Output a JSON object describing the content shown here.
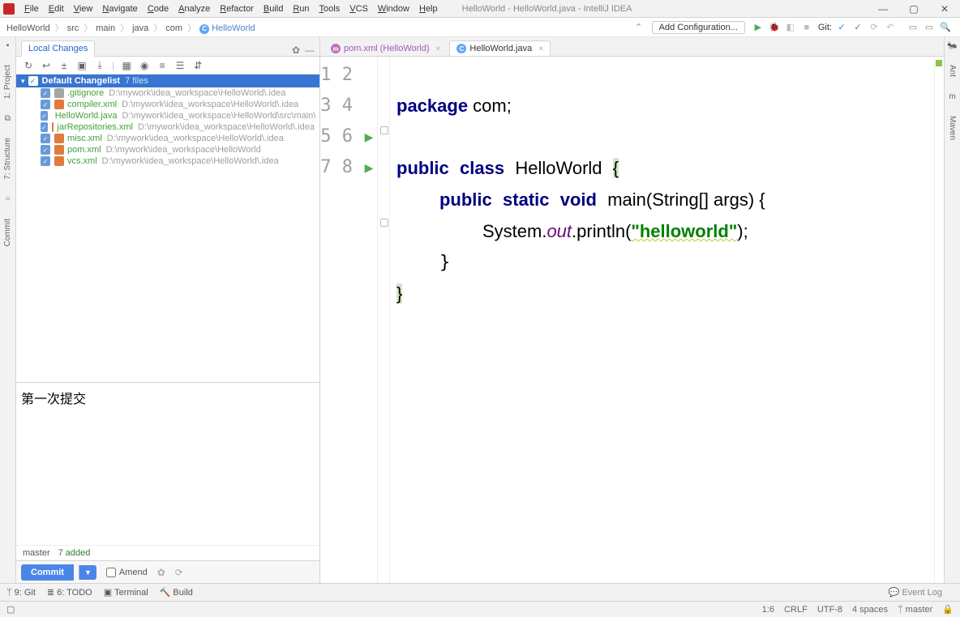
{
  "window": {
    "title": "HelloWorld - HelloWorld.java - IntelliJ IDEA",
    "menu": [
      "File",
      "Edit",
      "View",
      "Navigate",
      "Code",
      "Analyze",
      "Refactor",
      "Build",
      "Run",
      "Tools",
      "VCS",
      "Window",
      "Help"
    ]
  },
  "breadcrumbs": [
    "HelloWorld",
    "src",
    "main",
    "java",
    "com",
    "HelloWorld"
  ],
  "toolbar": {
    "add_config": "Add Configuration...",
    "git_label": "Git:"
  },
  "left_tabs": [
    "1: Project",
    "7: Structure",
    "Commit"
  ],
  "right_tabs": [
    "Ant",
    "Maven"
  ],
  "commit_panel": {
    "tab": "Local Changes",
    "changelist": {
      "name": "Default Changelist",
      "meta": "7 files"
    },
    "files": [
      {
        "name": ".gitignore",
        "path": "D:\\mywork\\idea_workspace\\HelloWorld\\.idea",
        "icon": "txt"
      },
      {
        "name": "compiler.xml",
        "path": "D:\\mywork\\idea_workspace\\HelloWorld\\.idea",
        "icon": "xml"
      },
      {
        "name": "HelloWorld.java",
        "path": "D:\\mywork\\idea_workspace\\HelloWorld\\src\\main\\",
        "icon": "java"
      },
      {
        "name": "jarRepositories.xml",
        "path": "D:\\mywork\\idea_workspace\\HelloWorld\\.idea",
        "icon": "xml"
      },
      {
        "name": "misc.xml",
        "path": "D:\\mywork\\idea_workspace\\HelloWorld\\.idea",
        "icon": "xml"
      },
      {
        "name": "pom.xml",
        "path": "D:\\mywork\\idea_workspace\\HelloWorld",
        "icon": "xml"
      },
      {
        "name": "vcs.xml",
        "path": "D:\\mywork\\idea_workspace\\HelloWorld\\.idea",
        "icon": "xml"
      }
    ],
    "message": "第一次提交",
    "branch": "master",
    "added": "7 added",
    "commit_btn": "Commit",
    "amend": "Amend"
  },
  "editor": {
    "tabs": [
      {
        "name": "pom.xml (HelloWorld)",
        "type": "m",
        "active": false
      },
      {
        "name": "HelloWorld.java",
        "type": "c",
        "active": true
      }
    ],
    "lines": [
      "1",
      "2",
      "3",
      "4",
      "5",
      "6",
      "7",
      "8"
    ],
    "code": {
      "l1_kw": "package",
      "l1_rest": " com;",
      "l3_kw1": "public",
      "l3_kw2": "class",
      "l3_cls": "HelloWorld",
      "l4_kw1": "public",
      "l4_kw2": "static",
      "l4_kw3": "void",
      "l4_m": "main",
      "l4_rest": "(String[] args) {",
      "l5_sys": "System.",
      "l5_out": "out",
      "l5_mid": ".println(",
      "l5_str": "\"helloworld\"",
      "l5_end": ");"
    }
  },
  "bottom_tools": {
    "git": "9: Git",
    "todo": "6: TODO",
    "terminal": "Terminal",
    "build": "Build",
    "event_log": "Event Log"
  },
  "status": {
    "pos": "1:6",
    "le": "CRLF",
    "enc": "UTF-8",
    "indent": "4 spaces",
    "branch": "master"
  }
}
